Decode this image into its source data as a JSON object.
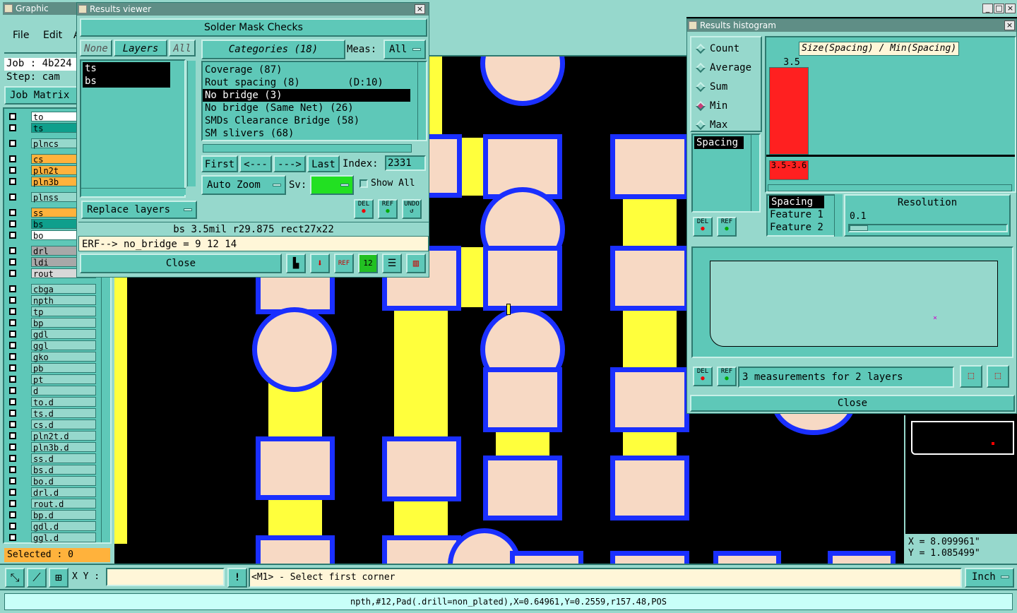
{
  "main_window": {
    "title": "Graphic Editor",
    "menu": [
      "File",
      "Edit",
      "A"
    ],
    "job": "Job : 4b224",
    "step": "Step: cam",
    "job_matrix": "Job Matrix",
    "selected": "Selected : 0"
  },
  "layers": [
    {
      "name": "to",
      "color": "#ffffff"
    },
    {
      "name": "ts",
      "color": "#0f9f8c"
    },
    {
      "name": "plncs",
      "color": "#96d8cc"
    },
    {
      "name": "cs",
      "color": "#ffb23c"
    },
    {
      "name": "pln2t",
      "color": "#ffb23c"
    },
    {
      "name": "pln3b",
      "color": "#ffb23c"
    },
    {
      "name": "plnss",
      "color": "#96d8cc"
    },
    {
      "name": "ss",
      "color": "#ffb23c"
    },
    {
      "name": "bs",
      "color": "#0f9f8c"
    },
    {
      "name": "bo",
      "color": "#ffffff"
    },
    {
      "name": "drl",
      "color": "#a8a8a8"
    },
    {
      "name": "ldi",
      "color": "#a8a8a8"
    },
    {
      "name": "rout",
      "color": "#d8d8d8"
    },
    {
      "name": "cbga",
      "color": "#96d8cc"
    },
    {
      "name": "npth",
      "color": "#96d8cc"
    },
    {
      "name": "tp",
      "color": "#96d8cc"
    },
    {
      "name": "bp",
      "color": "#96d8cc"
    },
    {
      "name": "gdl",
      "color": "#96d8cc"
    },
    {
      "name": "ggl",
      "color": "#96d8cc"
    },
    {
      "name": "gko",
      "color": "#96d8cc"
    },
    {
      "name": "pb",
      "color": "#96d8cc"
    },
    {
      "name": "pt",
      "color": "#96d8cc"
    },
    {
      "name": "d",
      "color": "#96d8cc"
    },
    {
      "name": "to.d",
      "color": "#96d8cc"
    },
    {
      "name": "ts.d",
      "color": "#96d8cc"
    },
    {
      "name": "cs.d",
      "color": "#96d8cc"
    },
    {
      "name": "pln2t.d",
      "color": "#96d8cc"
    },
    {
      "name": "pln3b.d",
      "color": "#96d8cc"
    },
    {
      "name": "ss.d",
      "color": "#96d8cc"
    },
    {
      "name": "bs.d",
      "color": "#96d8cc"
    },
    {
      "name": "bo.d",
      "color": "#96d8cc"
    },
    {
      "name": "drl.d",
      "color": "#96d8cc"
    },
    {
      "name": "rout.d",
      "color": "#96d8cc"
    },
    {
      "name": "bp.d",
      "color": "#96d8cc"
    },
    {
      "name": "gdl.d",
      "color": "#96d8cc"
    },
    {
      "name": "ggl.d",
      "color": "#96d8cc"
    }
  ],
  "results_viewer": {
    "title": "Results viewer",
    "header": "Solder Mask Checks",
    "none_btn": "None",
    "layers_btn": "Layers",
    "all_btn": "All",
    "layer_list": [
      "ts",
      "bs"
    ],
    "categories_btn": "Categories (18)",
    "meas_label": "Meas:",
    "meas_value": "All",
    "categories": [
      "Coverage (87)",
      "Rout spacing (8)        (D:10)",
      "No bridge (3)",
      "No bridge (Same Net) (26)",
      "SMDs Clearance Bridge (58)",
      "SM slivers (68)"
    ],
    "first": "First",
    "prev": "<---",
    "next": "--->",
    "last": "Last",
    "index_label": "Index:",
    "index_value": "2331",
    "auto_zoom": "Auto Zoom",
    "sv_label": "Sv:",
    "show_all": "Show All",
    "replace_layers": "Replace layers",
    "del": "DEL",
    "ref": "REF",
    "undo": "UNDO",
    "info": "bs 3.5mil  r29.875  rect27x22",
    "erf": "ERF--> no_bridge = 9 12 14",
    "close": "Close"
  },
  "histogram": {
    "title": "Results histogram",
    "options": [
      "Count",
      "Average",
      "Sum",
      "Min",
      "Max"
    ],
    "selected_option": "Min",
    "list_item": "Spacing",
    "chart_title": "Size(Spacing) / Min(Spacing)",
    "columns": [
      "Spacing",
      "Feature 1",
      "Feature 2"
    ],
    "resolution_label": "Resolution",
    "resolution_value": "0.1",
    "del": "DEL",
    "ref": "REF",
    "summary": "3 measurements for 2 layers",
    "close": "Close",
    "chart_data": {
      "type": "bar",
      "categories": [
        "3.5-3.6"
      ],
      "values": [
        3.5
      ],
      "title": "Size(Spacing) / Min(Spacing)",
      "bar_color": "#ff2020"
    }
  },
  "coords": {
    "x": "X = 8.099961\"",
    "y": "Y = 1.085499\""
  },
  "statusbar": {
    "xy_label": "X Y :",
    "xy_value": "",
    "prompt": "<M1> - Select first corner",
    "units": "Inch",
    "info": "npth,#12,Pad(.drill=non_plated),X=0.64961,Y=0.2559,r157.48,POS"
  }
}
